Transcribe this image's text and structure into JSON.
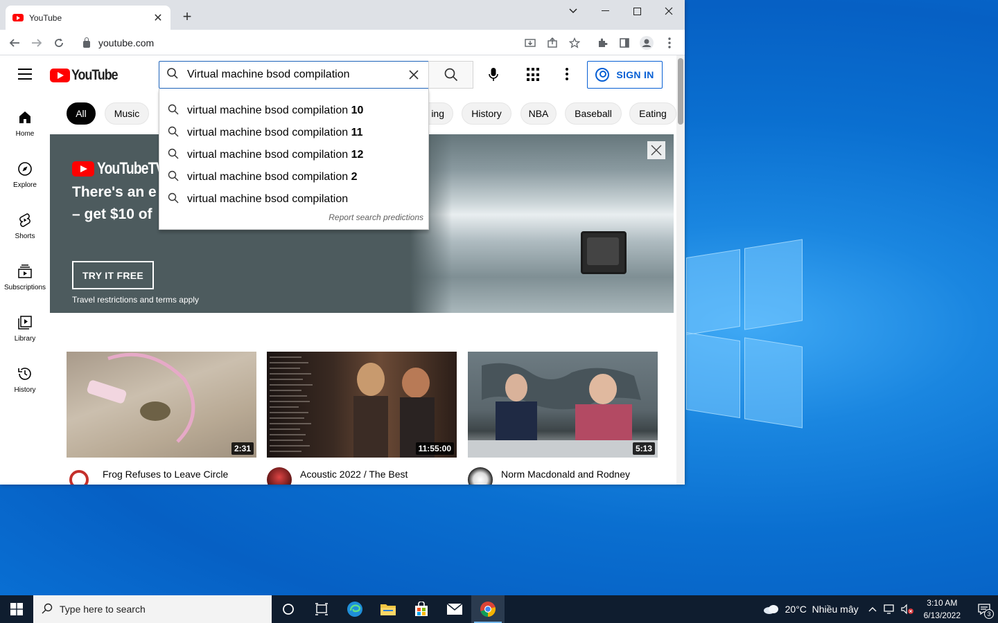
{
  "browser": {
    "tab_title": "YouTube",
    "url": "youtube.com"
  },
  "youtube": {
    "logo_text": "YouTube",
    "search_value": "Virtual machine bsod compilation",
    "signin_label": "SIGN IN",
    "guide": [
      {
        "label": "Home",
        "icon": "home-icon"
      },
      {
        "label": "Explore",
        "icon": "compass-icon"
      },
      {
        "label": "Shorts",
        "icon": "shorts-icon"
      },
      {
        "label": "Subscriptions",
        "icon": "subscriptions-icon"
      },
      {
        "label": "Library",
        "icon": "library-icon"
      },
      {
        "label": "History",
        "icon": "history-icon"
      }
    ],
    "chips": [
      {
        "label": "All"
      },
      {
        "label": "Music"
      },
      {
        "label": "ing"
      },
      {
        "label": "History"
      },
      {
        "label": "NBA"
      },
      {
        "label": "Baseball"
      },
      {
        "label": "Eating"
      }
    ],
    "suggestions": [
      {
        "prefix": "virtual machine bsod compilation",
        "suffix": " 10"
      },
      {
        "prefix": "virtual machine bsod compilation",
        "suffix": " 11"
      },
      {
        "prefix": "virtual machine bsod compilation",
        "suffix": " 12"
      },
      {
        "prefix": "virtual machine bsod compilation",
        "suffix": " 2"
      },
      {
        "prefix": "virtual machine bsod compilation",
        "suffix": ""
      }
    ],
    "report_predictions": "Report search predictions",
    "banner": {
      "logo_text": "YouTubeTV",
      "headline_1": "There's an e",
      "headline_2": "– get $10 of",
      "cta": "TRY IT FREE",
      "terms": "Travel restrictions and terms apply"
    },
    "videos": [
      {
        "title": "Frog Refuses to Leave Circle",
        "duration": "2:31"
      },
      {
        "title": "Acoustic 2022 / The Best",
        "duration": "11:55:00"
      },
      {
        "title": "Norm Macdonald and Rodney",
        "duration": "5:13"
      }
    ]
  },
  "taskbar": {
    "search_placeholder": "Type here to search",
    "weather": "20°C  Nhiều mây",
    "time": "3:10 AM",
    "date": "6/13/2022",
    "notification_count": "3"
  }
}
